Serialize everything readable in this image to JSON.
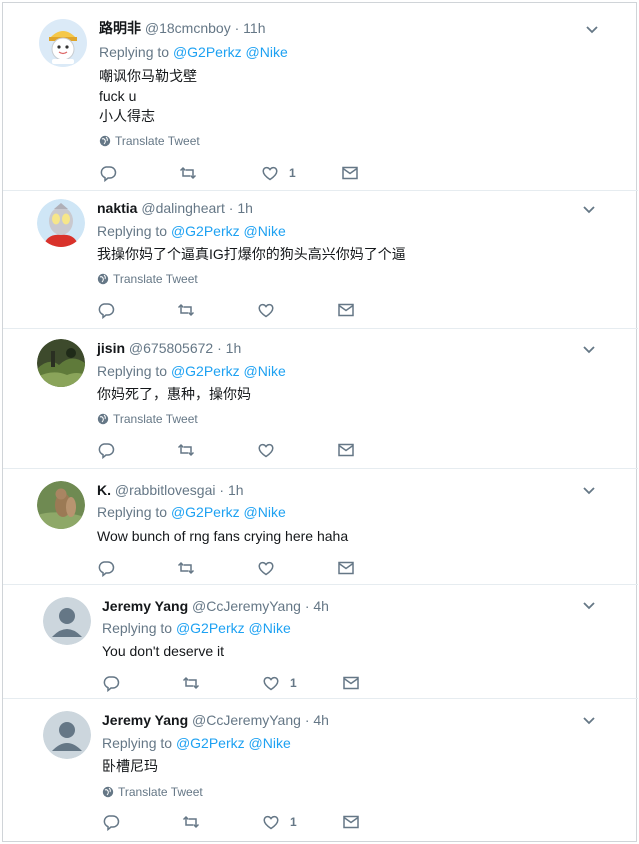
{
  "tweets": [
    {
      "name": "路明非",
      "handle": "@18cmcnboy",
      "time": "11h",
      "replying_label": "Replying to",
      "mentions": [
        "@G2Perkz",
        "@Nike"
      ],
      "lines": [
        "嘲讽你马勒戈壁",
        "fuck u",
        "小人得志"
      ],
      "translate": "Translate Tweet",
      "likes": "1",
      "avatar": "cartoon-avatar"
    },
    {
      "name": "naktia",
      "handle": "@dalingheart",
      "time": "1h",
      "replying_label": "Replying to",
      "mentions": [
        "@G2Perkz",
        "@Nike"
      ],
      "lines": [
        "我操你妈了个逼真IG打爆你的狗头高兴你妈了个逼"
      ],
      "translate": "Translate Tweet",
      "likes": "",
      "avatar": "ultraman-avatar"
    },
    {
      "name": "jisin",
      "handle": "@675805672",
      "time": "1h",
      "replying_label": "Replying to",
      "mentions": [
        "@G2Perkz",
        "@Nike"
      ],
      "lines": [
        "你妈死了，惠种，操你妈"
      ],
      "translate": "Translate Tweet",
      "likes": "",
      "avatar": "landscape-avatar"
    },
    {
      "name": "K.",
      "handle": "@rabbitlovesgai",
      "time": "1h",
      "replying_label": "Replying to",
      "mentions": [
        "@G2Perkz",
        "@Nike"
      ],
      "lines": [
        "Wow bunch of rng fans crying here haha"
      ],
      "translate": "",
      "likes": "",
      "avatar": "squirrel-avatar"
    },
    {
      "name": "Jeremy Yang",
      "handle": "@CcJeremyYang",
      "time": "4h",
      "replying_label": "Replying to",
      "mentions": [
        "@G2Perkz",
        "@Nike"
      ],
      "lines": [
        "You don't deserve it"
      ],
      "translate": "",
      "likes": "1",
      "avatar": "default-avatar"
    },
    {
      "name": "Jeremy Yang",
      "handle": "@CcJeremyYang",
      "time": "4h",
      "replying_label": "Replying to",
      "mentions": [
        "@G2Perkz",
        "@Nike"
      ],
      "lines": [
        "卧槽尼玛"
      ],
      "translate": "Translate Tweet",
      "likes": "1",
      "avatar": "default-avatar"
    }
  ],
  "colors": {
    "link": "#1da1f2",
    "muted": "#657786",
    "text": "#14171a",
    "divider": "#e6ecf0"
  },
  "icons": {
    "reply": "reply-icon",
    "retweet": "retweet-icon",
    "like": "heart-icon",
    "dm": "envelope-icon",
    "caret": "chevron-down-icon",
    "globe": "globe-icon"
  }
}
